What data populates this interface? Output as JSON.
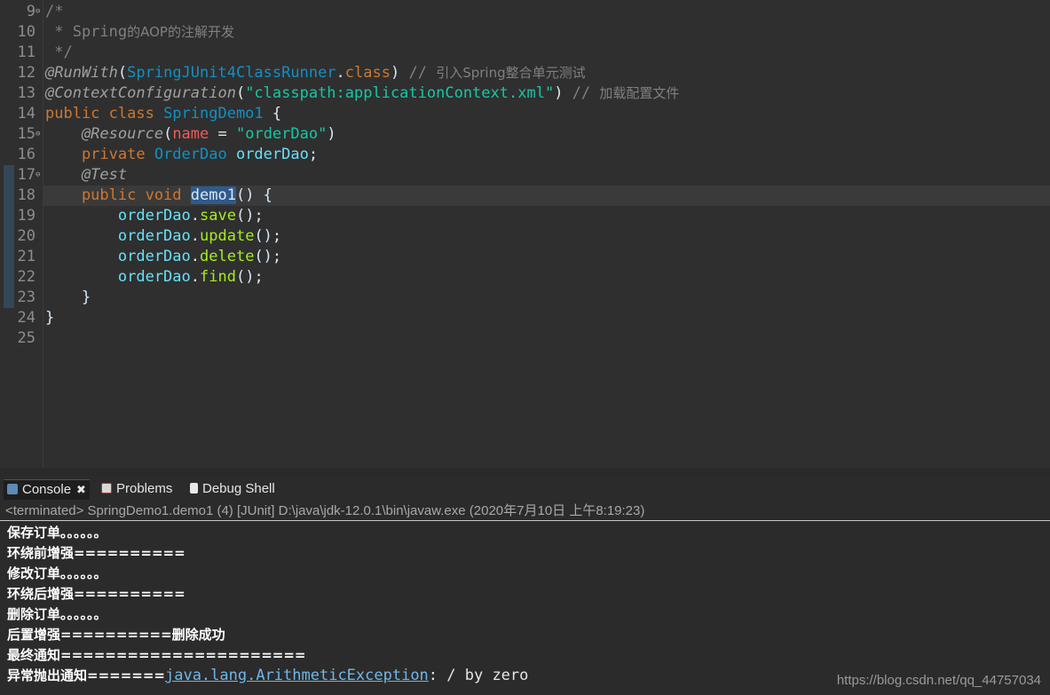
{
  "editor": {
    "line_numbers": [
      "9",
      "10",
      "11",
      "12",
      "13",
      "14",
      "15",
      "16",
      "17",
      "18",
      "19",
      "20",
      "21",
      "22",
      "23",
      "24",
      "25"
    ],
    "code": {
      "l9_comment": "/*",
      "l10_comment": " * Spring",
      "l10_cn": "的AOP的注解开发",
      "l11_comment": " */",
      "l12_ann": "@RunWith",
      "l12_open": "(",
      "l12_type": "SpringJUnit4ClassRunner",
      "l12_dot": ".",
      "l12_class": "class",
      "l12_close": ") ",
      "l12_comment": "// ",
      "l12_cn": "引入Spring整合单元测试",
      "l13_ann": "@ContextConfiguration",
      "l13_open": "(",
      "l13_str": "\"classpath:applicationContext.xml\"",
      "l13_close": ") ",
      "l13_comment": "// ",
      "l13_cn": "加载配置文件",
      "l14_kw": "public class ",
      "l14_type": "SpringDemo1",
      "l14_brace": " {",
      "l15_ann": "    @Resource",
      "l15_open": "(",
      "l15_attr": "name",
      "l15_eq": " = ",
      "l15_str": "\"orderDao\"",
      "l15_close": ")",
      "l16_kw": "    private ",
      "l16_type": "OrderDao ",
      "l16_field": "orderDao",
      "l16_semi": ";",
      "l17_ann": "    @Test",
      "l18_kw": "    public void ",
      "l18_method": "demo1",
      "l18_rest": "() {",
      "l19_field": "        orderDao",
      "l19_dot": ".",
      "l19_method": "save",
      "l19_rest": "();",
      "l20_field": "        orderDao",
      "l20_dot": ".",
      "l20_method": "update",
      "l20_rest": "();",
      "l21_field": "        orderDao",
      "l21_dot": ".",
      "l21_method": "delete",
      "l21_rest": "();",
      "l22_field": "        orderDao",
      "l22_dot": ".",
      "l22_method": "find",
      "l22_rest": "();",
      "l23": "    }",
      "l24": "}",
      "l25": ""
    }
  },
  "console": {
    "tabs": [
      {
        "label": "Console",
        "icon": "console-icon"
      },
      {
        "label": "Problems",
        "icon": "problems-icon"
      },
      {
        "label": "Debug Shell",
        "icon": "debug-shell-icon"
      }
    ],
    "close_glyph": "✖",
    "status": "<terminated> SpringDemo1.demo1 (4) [JUnit] D:\\java\\jdk-12.0.1\\bin\\javaw.exe (2020年7月10日 上午8:19:23)",
    "lines": [
      "保存订单。。。。。。",
      "环绕前增强==========",
      "修改订单。。。。。。",
      "环绕后增强==========",
      "删除订单。。。。。。",
      "后置增强==========删除成功",
      "最终通知======================"
    ],
    "last_prefix": "异常抛出通知=======",
    "last_exception": "java.lang.ArithmeticException",
    "last_message": ": / by zero"
  },
  "watermark": "https://blog.csdn.net/qq_44757034",
  "colors": {
    "background": "#2f2f2f",
    "keyword": "#cc7832",
    "type": "#1290c3",
    "string": "#17c6a3",
    "method": "#a7ec21",
    "field": "#66e1f8"
  }
}
